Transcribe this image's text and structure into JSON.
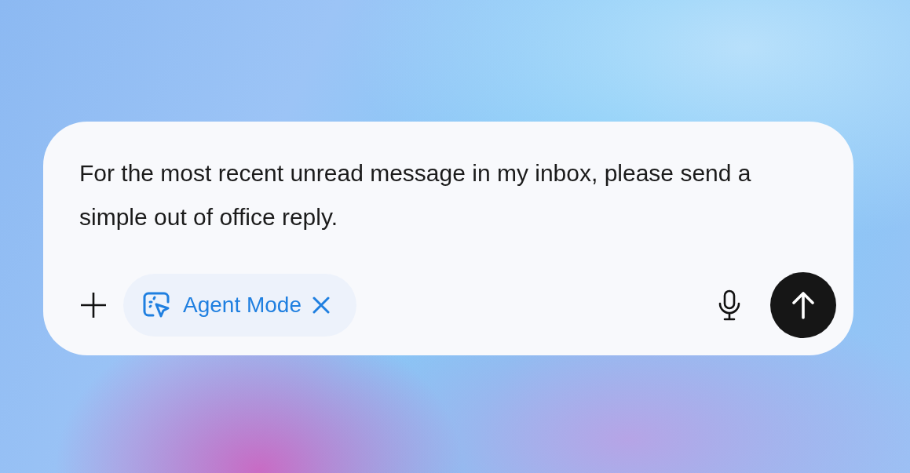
{
  "composer": {
    "value": "For the most recent unread message in my inbox, please send a simple out of office reply.",
    "mode_chip": {
      "label": "Agent Mode"
    }
  }
}
